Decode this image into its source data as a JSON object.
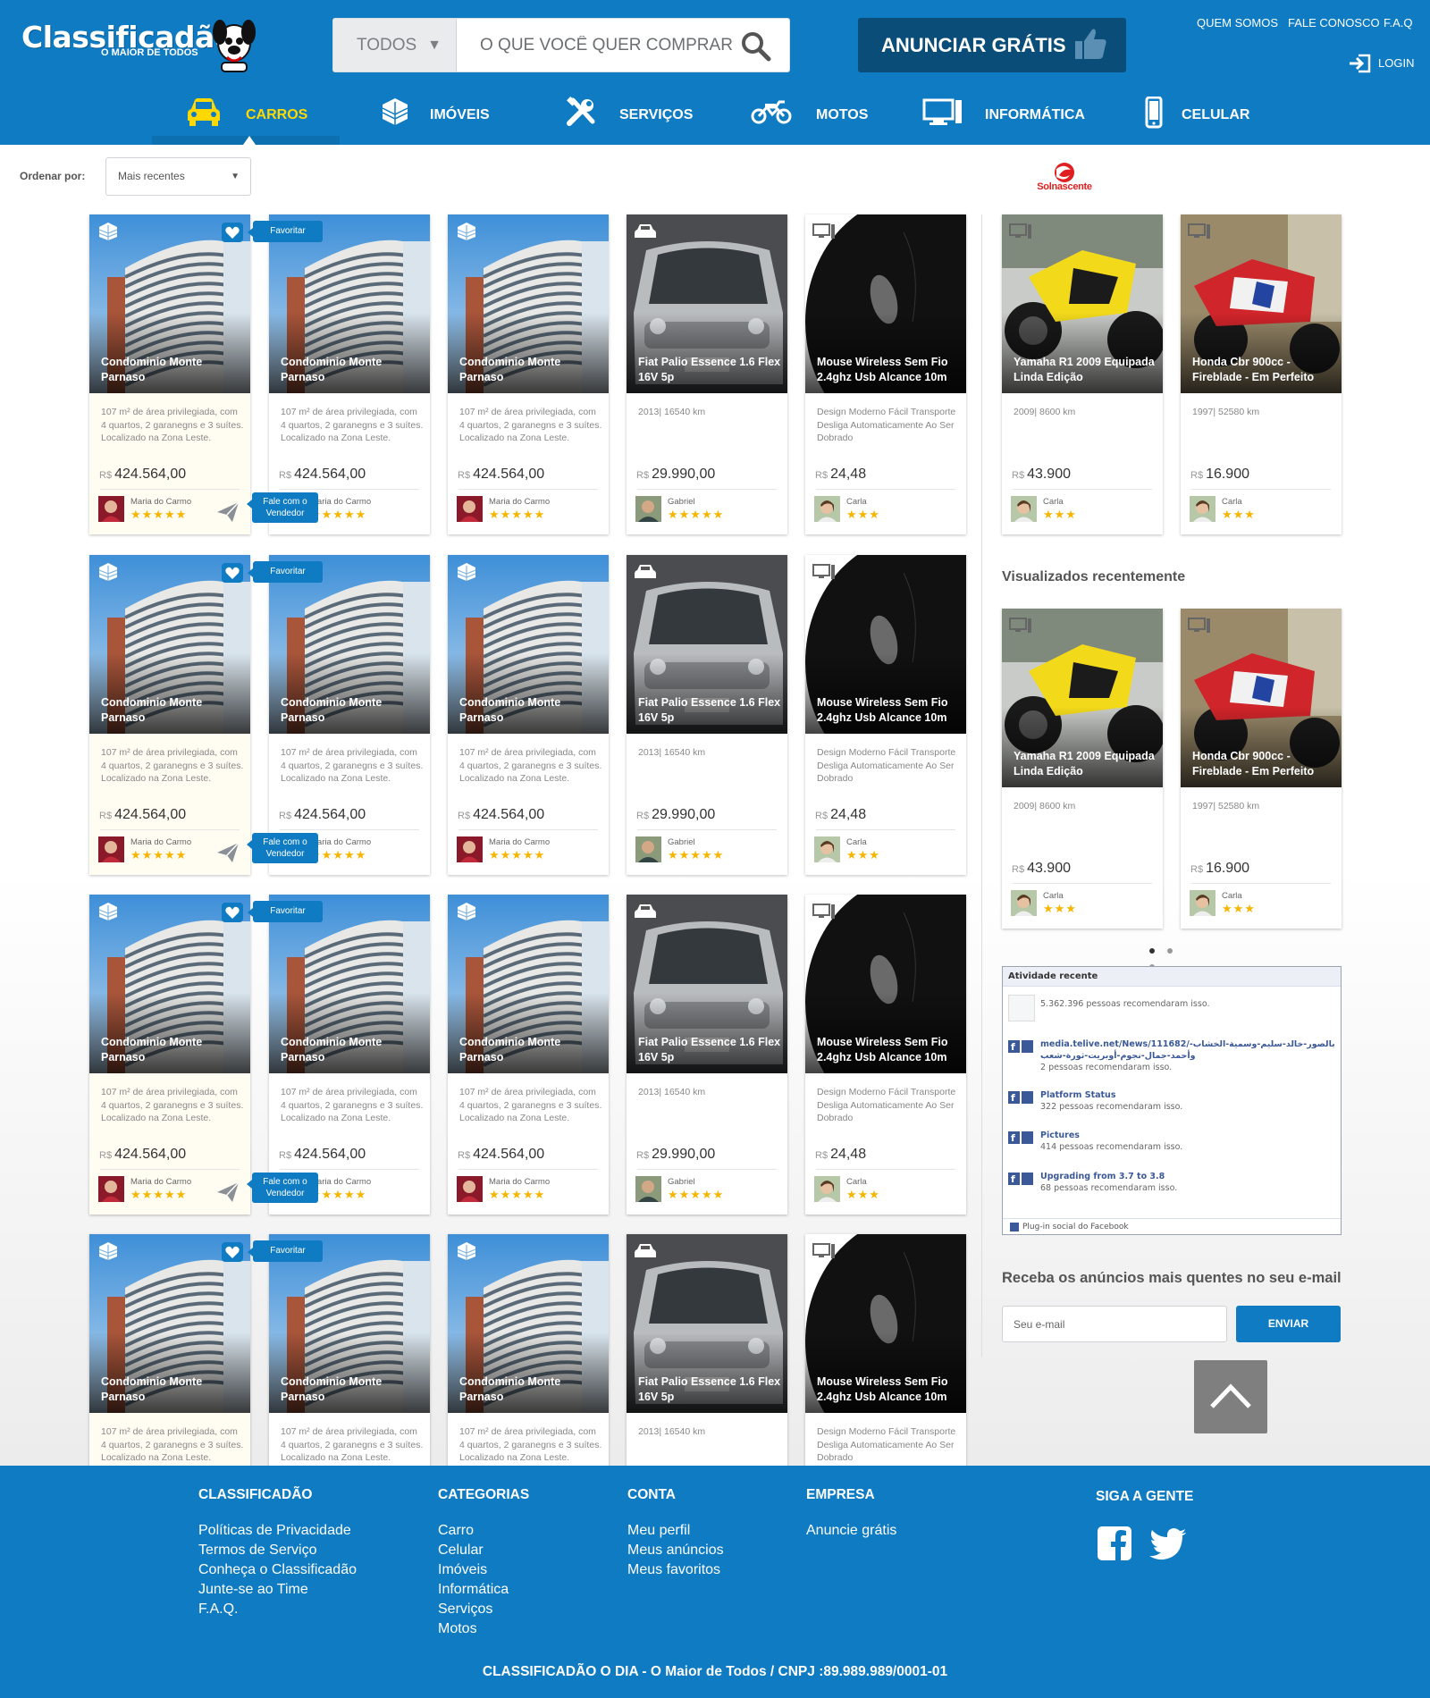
{
  "header": {
    "logo_text": "Classificadão",
    "logo_sub": "O MAIOR DE TODOS",
    "search_category": "TODOS",
    "search_placeholder": "O QUE VOCÊ QUER COMPRAR?",
    "announce_label": "ANUNCIAR GRÁTIS",
    "top_links": [
      "QUEM SOMOS",
      "FALE CONOSCO",
      "F.A.Q"
    ],
    "login_label": "LOGIN",
    "nav": [
      "CARROS",
      "IMÓVEIS",
      "SERVIÇOS",
      "MOTOS",
      "INFORMÁTICA",
      "CELULAR"
    ],
    "active_nav": "CARROS"
  },
  "sort": {
    "label": "Ordenar por:",
    "value": "Mais recentes"
  },
  "sponsor": "Solnascente",
  "tooltips": {
    "favorite": "Favoritar",
    "contact": "Fale com o Vendedor"
  },
  "listings": {
    "predio": {
      "title": "Condominio Monte Parnaso",
      "desc": "107 m² de área privilegiada, com 4 quartos, 2 garanegns e 3 suítes. Localizado na Zona Leste.",
      "currency": "R$",
      "price": "424.564,00",
      "seller": "Maria do Carmo",
      "stars": "★★★★★"
    },
    "fiat": {
      "title": "Fiat Palio Essence 1.6 Flex 16V 5p",
      "desc": "2013| 16540 km",
      "currency": "R$",
      "price": "29.990,00",
      "seller": "Gabriel",
      "stars": "★★★★★"
    },
    "mouse": {
      "title": "Mouse Wireless Sem Fio 2.4ghz Usb Alcance 10m",
      "desc": "Design Moderno Fácil Transporte Desliga Automaticamente Ao Ser Dobrado",
      "currency": "R$",
      "price": "24,48",
      "seller": "Carla",
      "stars": "★★★"
    },
    "yamaha": {
      "title": "Yamaha R1 2009 Equipada Linda Edição",
      "desc": "2009| 8600 km",
      "currency": "R$",
      "price": "43.900",
      "seller": "Carla",
      "stars": "★★★"
    },
    "honda": {
      "title": "Honda Cbr 900cc - Fireblade - Em Perfeito",
      "desc": "1997| 52580 km",
      "currency": "R$",
      "price": "16.900",
      "seller": "Carla",
      "stars": "★★★"
    }
  },
  "recently_viewed_title": "Visualizados recentemente",
  "facebook": {
    "header": "Atividade recente",
    "items": [
      {
        "link": "",
        "text": "5.362.396 pessoas recomendaram isso."
      },
      {
        "link": " media.telive.net/News/111682/بالصور-خالد-سليم-وسمية-الخشاب-وأحمد-جمال-نجوم-أوبريت-ثورة-شعب",
        "text": "2 pessoas recomendaram isso."
      },
      {
        "link": "Platform Status",
        "text": "322 pessoas recomendaram isso."
      },
      {
        "link": "Pictures",
        "text": "414 pessoas recomendaram isso."
      },
      {
        "link": "Upgrading from 3.7 to 3.8",
        "text": "68 pessoas recomendaram isso."
      }
    ],
    "footer": "Plug-in social do Facebook"
  },
  "newsletter": {
    "title": "Receba os anúncios mais quentes no seu e-mail",
    "placeholder": "Seu e-mail",
    "button": "ENVIAR"
  },
  "footer": {
    "columns": [
      {
        "title": "CLASSIFICADÃO",
        "links": [
          "Políticas de Privacidade",
          "Termos de Serviço",
          "Conheça o Classificadão",
          "Junte-se ao Time",
          "F.A.Q."
        ]
      },
      {
        "title": "CATEGORIAS",
        "links": [
          "Carro",
          "Celular",
          "Imóveis",
          "Informática",
          "Serviços",
          "Motos"
        ]
      },
      {
        "title": "CONTA",
        "links": [
          "Meu perfil",
          "Meus anúncios",
          "Meus favoritos"
        ]
      },
      {
        "title": "EMPRESA",
        "links": [
          "Anuncie grátis"
        ]
      }
    ],
    "social_title": "SIGA A GENTE",
    "copyright": "CLASSIFICADÃO O DIA - O Maior de Todos / CNPJ :89.989.989/0001-01"
  },
  "colors": {
    "brand_blue": "#0e7bc2",
    "dark_blue": "#0a4d78",
    "active_yellow": "#ffd800",
    "star": "#f7b500"
  }
}
